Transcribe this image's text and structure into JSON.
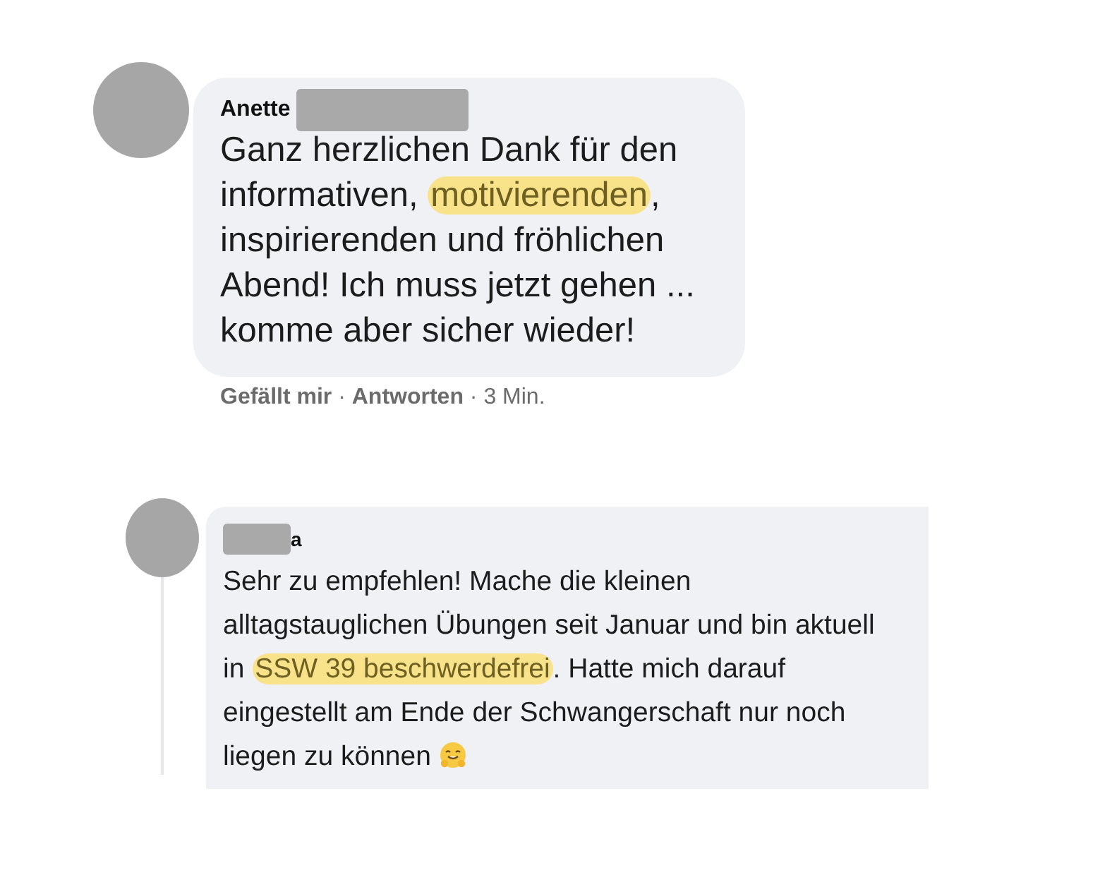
{
  "comments": [
    {
      "author": "Anette",
      "redacted": true,
      "body": [
        {
          "text": "Ganz herzlichen Dank für den\ninformativen, ",
          "highlighted": false
        },
        {
          "text": "motivierenden",
          "highlighted": true
        },
        {
          "text": ",\ninspirierenden und fröhlichen\nAbend! Ich muss jetzt gehen ...\nkomme aber sicher wieder!",
          "highlighted": false
        }
      ],
      "actions": [
        {
          "text": "Gefällt mir",
          "kind": "link"
        },
        {
          "text": " · ",
          "kind": "sep"
        },
        {
          "text": "Antworten",
          "kind": "link"
        },
        {
          "text": " · ",
          "kind": "sep"
        },
        {
          "text": "3 Min.",
          "kind": "time"
        }
      ],
      "replies": [
        {
          "author": "a",
          "redacted": true,
          "body": [
            {
              "text": "Sehr zu empfehlen! Mache die kleinen\nalltagstauglichen Übungen seit Januar und bin aktuell\nin ",
              "highlighted": false
            },
            {
              "text": "SSW 39 beschwerdefrei",
              "highlighted": true
            },
            {
              "text": ". Hatte mich darauf\neingestellt am Ende der Schwangerschaft nur noch\nliegen zu können",
              "highlighted": false
            }
          ],
          "emoji": true
        }
      ]
    }
  ]
}
